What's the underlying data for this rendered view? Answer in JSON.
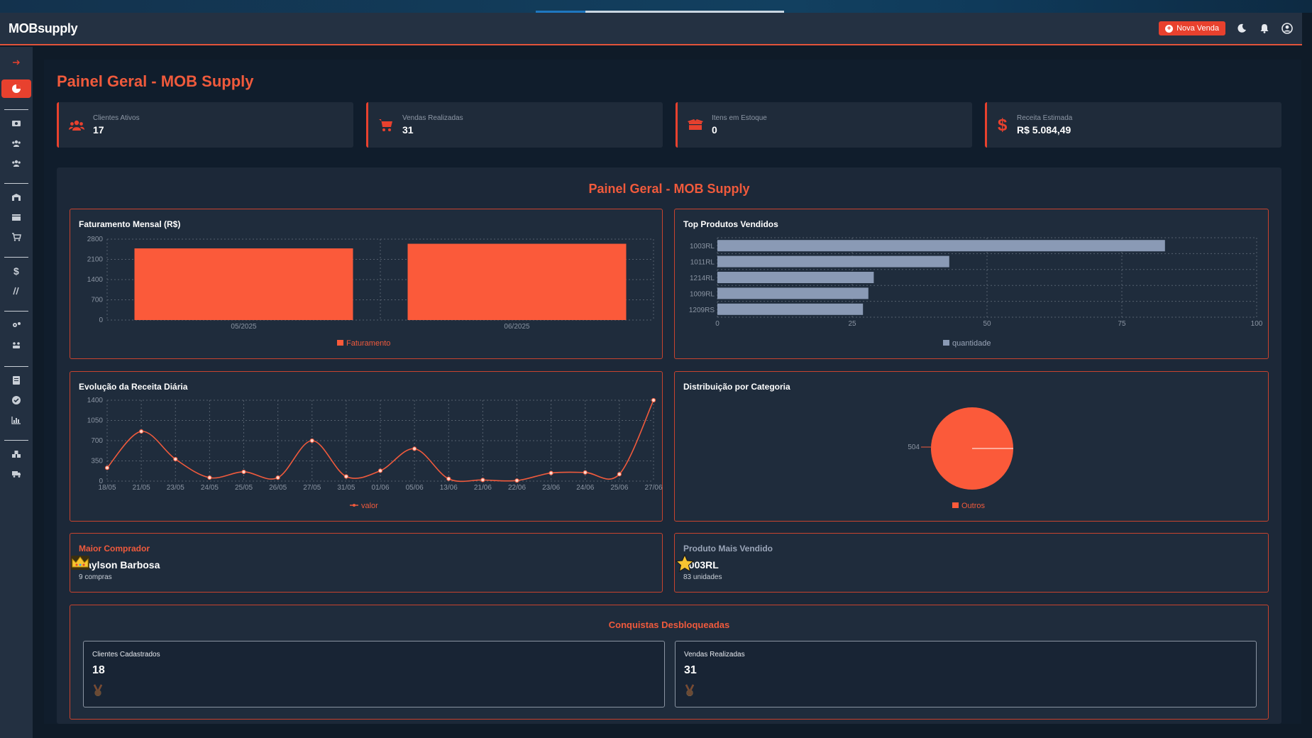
{
  "app": {
    "brand": "MOBsupply"
  },
  "topbar": {
    "new_sale_label": "Nova Venda"
  },
  "page": {
    "title": "Painel Geral - MOB Supply"
  },
  "stats": [
    {
      "label": "Clientes Ativos",
      "value": "17",
      "icon": "users-icon"
    },
    {
      "label": "Vendas Realizadas",
      "value": "31",
      "icon": "cart-icon"
    },
    {
      "label": "Itens em Estoque",
      "value": "0",
      "icon": "box-icon"
    },
    {
      "label": "Receita Estimada",
      "value": "R$ 5.084,49",
      "icon": "dollar-icon"
    }
  ],
  "panel": {
    "title": "Painel Geral - MOB Supply"
  },
  "charts": {
    "monthly": {
      "title": "Faturamento Mensal (R$)",
      "legend": "Faturamento"
    },
    "top_products": {
      "title": "Top Produtos Vendidos",
      "legend": "quantidade"
    },
    "daily": {
      "title": "Evolução da Receita Diária",
      "legend": "valor"
    },
    "category": {
      "title": "Distribuição por Categoria",
      "legend": "Outros",
      "slice_label": "504"
    }
  },
  "chart_data": [
    {
      "type": "bar",
      "title": "Faturamento Mensal (R$)",
      "categories": [
        "05/2025",
        "06/2025"
      ],
      "series": [
        {
          "name": "Faturamento",
          "values": [
            2480,
            2640
          ]
        }
      ],
      "yticks": [
        0,
        700,
        1400,
        2100,
        2800
      ],
      "ylim": [
        0,
        2800
      ],
      "color": "#fb5a3a",
      "grid": true,
      "legend": "bottom"
    },
    {
      "type": "bar",
      "orientation": "horizontal",
      "title": "Top Produtos Vendidos",
      "categories": [
        "1003RL",
        "1011RL",
        "1214RL",
        "1009RL",
        "1209RS"
      ],
      "series": [
        {
          "name": "quantidade",
          "values": [
            83,
            43,
            29,
            28,
            27
          ]
        }
      ],
      "xticks": [
        0,
        25,
        50,
        75,
        100
      ],
      "xlim": [
        0,
        100
      ],
      "color": "#8a9ab5",
      "grid": true,
      "legend": "bottom"
    },
    {
      "type": "line",
      "title": "Evolução da Receita Diária",
      "x": [
        "18/05",
        "21/05",
        "23/05",
        "24/05",
        "25/05",
        "26/05",
        "27/05",
        "31/05",
        "01/06",
        "05/06",
        "13/06",
        "21/06",
        "22/06",
        "23/06",
        "24/06",
        "25/06",
        "27/06"
      ],
      "series": [
        {
          "name": "valor",
          "values": [
            230,
            860,
            380,
            60,
            160,
            60,
            700,
            80,
            180,
            560,
            40,
            20,
            10,
            140,
            150,
            120,
            1400
          ]
        }
      ],
      "yticks": [
        0,
        350,
        700,
        1050,
        1400
      ],
      "ylim": [
        0,
        1400
      ],
      "color": "#f05a3c",
      "grid": true,
      "legend": "bottom"
    },
    {
      "type": "pie",
      "title": "Distribuição por Categoria",
      "categories": [
        "Outros"
      ],
      "series": [
        {
          "name": "Outros",
          "values": [
            504
          ]
        }
      ],
      "color": "#fb5a3a",
      "legend": "bottom"
    }
  ],
  "highlights": {
    "top_buyer": {
      "label": "Maior Comprador",
      "name": "Raylson Barbosa",
      "sub": "9 compras",
      "icon": "crown-icon"
    },
    "top_product": {
      "label": "Produto Mais Vendido",
      "name": "1003RL",
      "sub": "83 unidades",
      "icon": "star-icon"
    }
  },
  "achievements": {
    "title": "Conquistas Desbloqueadas",
    "items": [
      {
        "label": "Clientes Cadastrados",
        "value": "18"
      },
      {
        "label": "Vendas Realizadas",
        "value": "31"
      }
    ]
  },
  "colors": {
    "accent": "#e8412e",
    "bar": "#fb5a3a",
    "hbar": "#8a9ab5",
    "bg": "#101d2c"
  }
}
